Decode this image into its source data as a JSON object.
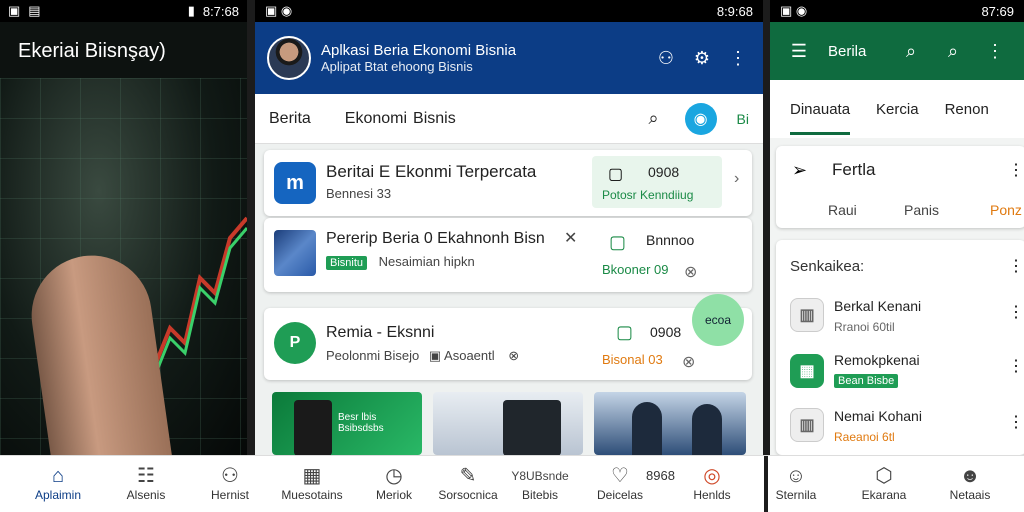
{
  "left": {
    "status": {
      "time": "8:7:68"
    },
    "title": "Ekeriai Biisnşay)"
  },
  "middle": {
    "status": {
      "time": "8:9:68"
    },
    "appbar": {
      "title": "Aplkasi Beria Ekonomi Bisnia",
      "subtitle": "Aplipat Btat ehoong Bisnis"
    },
    "tabs": [
      "Berita",
      "Ekonomi",
      "Bisnis"
    ],
    "tab_badge": "Bi",
    "cards": [
      {
        "icon_text": "m",
        "title": "Beritai E Ekonmi Terpercata",
        "sub": "Bennesi 33",
        "side_num": "0908",
        "side_label": "Potosr Kenndiiug"
      },
      {
        "title": "Pererip Beria 0 Ekahnonh Bisn",
        "chip": "Bisnitu",
        "sub": "Nesaimian hipkn",
        "side_title": "Bnnnoo",
        "side_label": "Bkooner 09"
      },
      {
        "icon_text": "P",
        "title": "Remia - Eksnni",
        "sub": "Peolonmi Bisejo",
        "sub2": "Asoaentl",
        "side_num": "0908",
        "side_label": "Bisonal 03",
        "badge": "ecoa"
      }
    ],
    "thumb_text": "Besr lbis Bsibsdsbs"
  },
  "right": {
    "status": {
      "time": "87:69"
    },
    "appbar": {
      "title": "Berila"
    },
    "tabs": [
      "Dinauata",
      "Kercia",
      "Renon"
    ],
    "card1": {
      "title": "Fertla",
      "sub": [
        "Raui",
        "Panis",
        "Ponz"
      ]
    },
    "section": "Senkaikea:",
    "items": [
      {
        "title": "Berkal Kenani",
        "sub": "Rranoi 60til",
        "style": "gray"
      },
      {
        "title": "Remokpkenai",
        "chip": "Bean Bisbe",
        "style": "green"
      },
      {
        "title": "Nemai Kohani",
        "sub": "Raeanoi 6tl",
        "style": "orange"
      }
    ]
  },
  "nav": [
    {
      "label": "Aplaimin",
      "icon": "home-icon",
      "glyph": "⌂"
    },
    {
      "label": "Alsenis",
      "icon": "news-icon",
      "glyph": "☷"
    },
    {
      "label": "Hernist",
      "icon": "people-icon",
      "glyph": "⚇"
    },
    {
      "label": "Muesotains",
      "icon": "grid-icon",
      "glyph": "▦"
    },
    {
      "label": "Meriok",
      "icon": "clock-icon",
      "glyph": "◷"
    },
    {
      "label": "Sorsocnica",
      "icon": "edit-icon",
      "glyph": "✎"
    },
    {
      "label": "Bitebis",
      "icon": "bookmark-icon",
      "glyph": "☰",
      "extra": "Y8UBsnde"
    },
    {
      "label": "Deicelas",
      "icon": "heart-icon",
      "glyph": "♡",
      "extra": "8968"
    },
    {
      "label": "Henlds",
      "icon": "bell-icon",
      "glyph": "◎"
    },
    {
      "label": "Sternila",
      "icon": "user-icon",
      "glyph": "☺"
    },
    {
      "label": "Ekarana",
      "icon": "shield-icon",
      "glyph": "⬡"
    },
    {
      "label": "Netaais",
      "icon": "profile-icon",
      "glyph": "☻"
    }
  ]
}
